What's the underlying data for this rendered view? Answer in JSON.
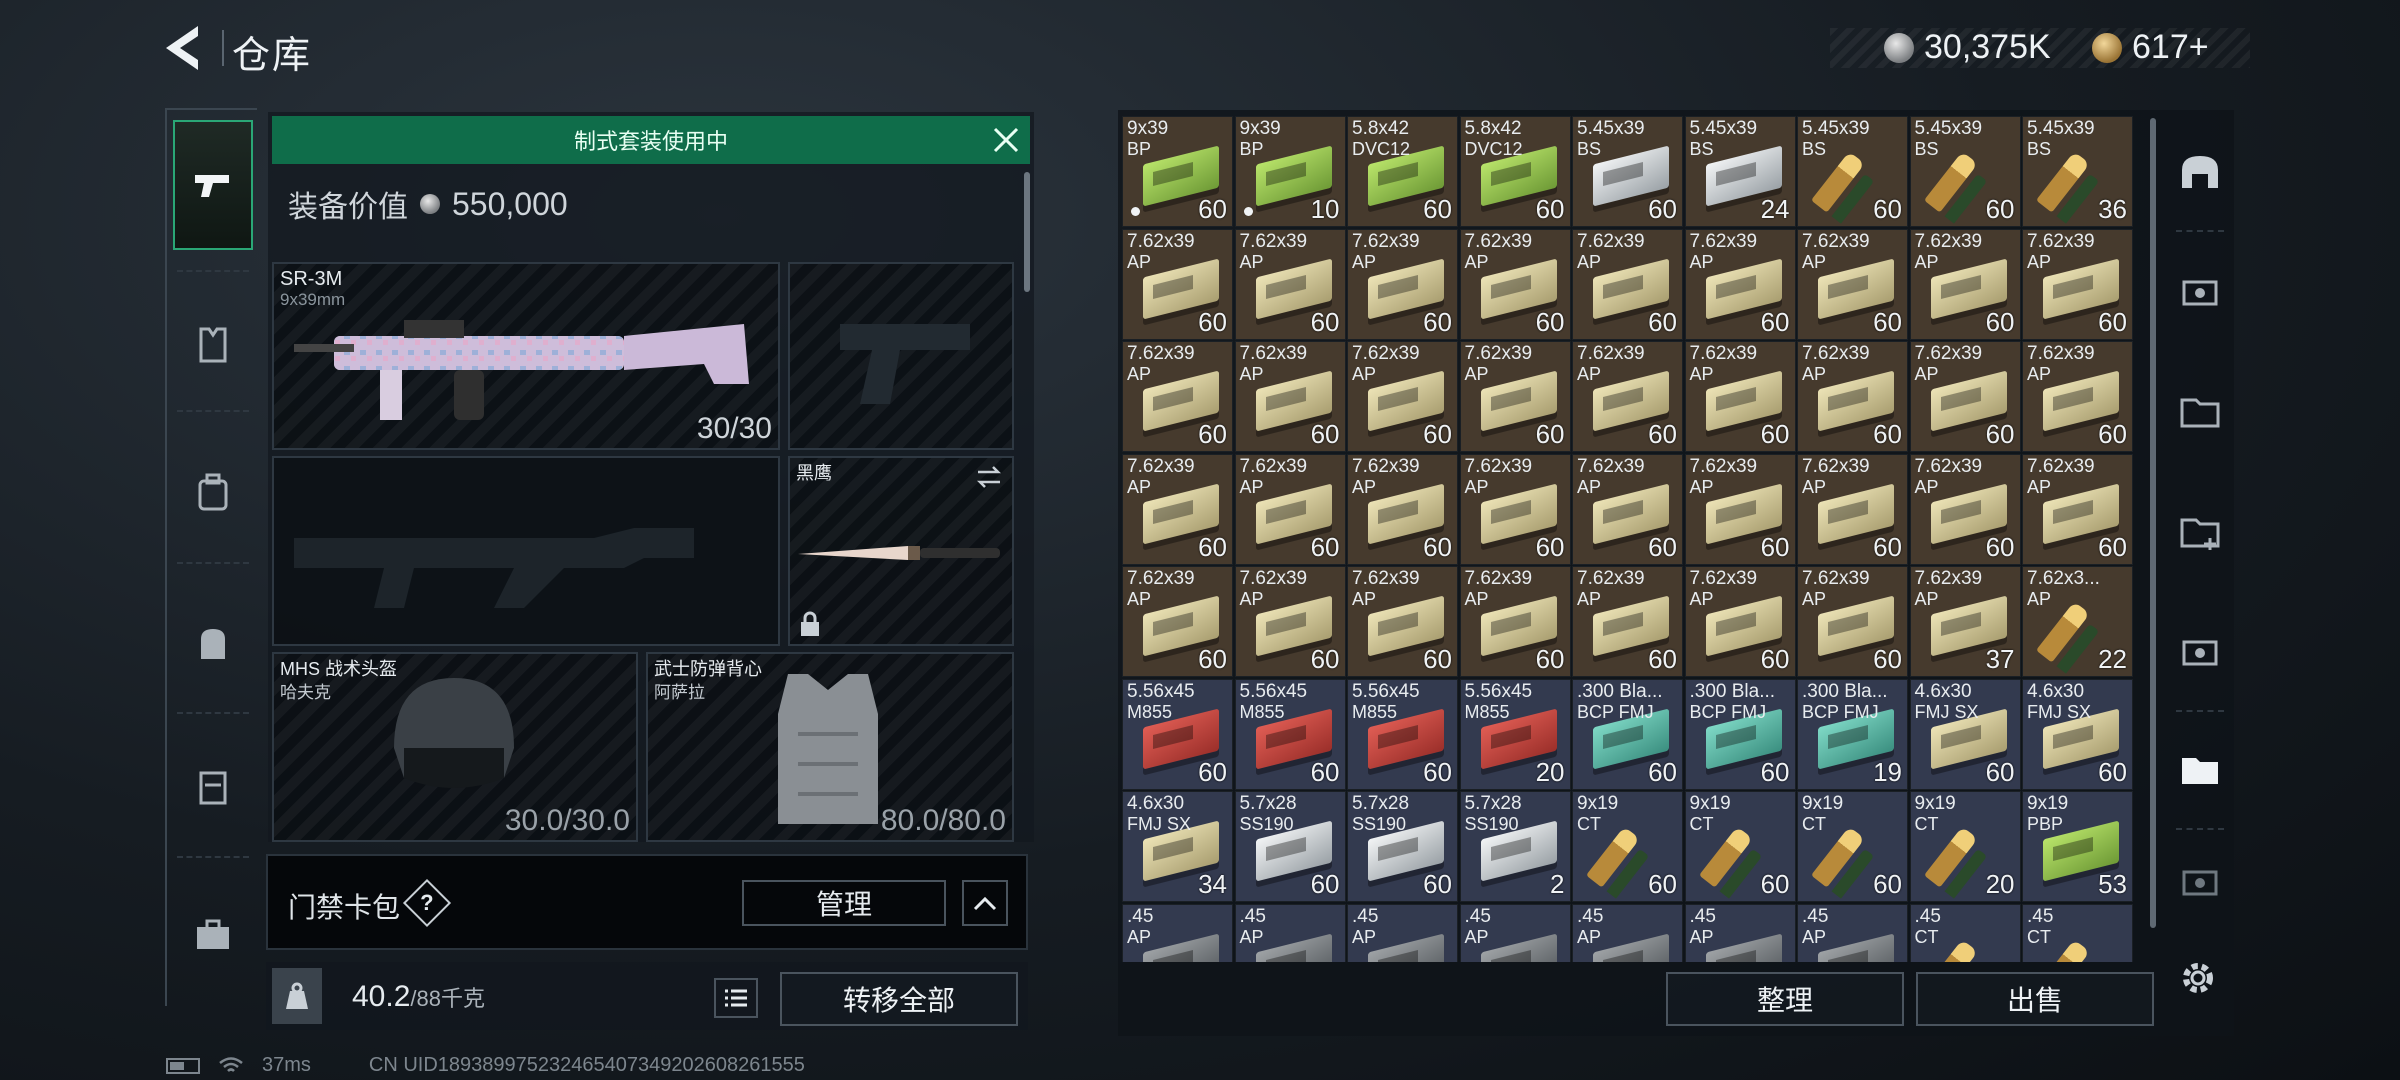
{
  "header": {
    "title": "仓库",
    "currency_silver": "30,375K",
    "currency_gold": "617+"
  },
  "left_tabs": [
    {
      "name": "weapons",
      "icon": "pistol-icon",
      "active": true
    },
    {
      "name": "gear",
      "icon": "vest-icon",
      "active": false
    },
    {
      "name": "backpack",
      "icon": "backpack-icon",
      "active": false
    },
    {
      "name": "bag",
      "icon": "bag-icon",
      "active": false
    },
    {
      "name": "container",
      "icon": "case-icon",
      "active": false
    },
    {
      "name": "toolbox",
      "icon": "toolbox-icon",
      "active": false
    }
  ],
  "loadout": {
    "preset_banner": "制式套装使用中",
    "value_label": "装备价值",
    "value": "550,000",
    "primary": {
      "name": "SR-3M",
      "caliber": "9x39mm",
      "ammo": "30/30"
    },
    "melee": {
      "name": "黑鹰"
    },
    "helmet": {
      "name": "MHS 战术头盔",
      "maker": "哈夫克",
      "durability": "30.0/30.0"
    },
    "armor": {
      "name": "武士防弹背心",
      "maker": "阿萨拉",
      "durability": "80.0/80.0"
    },
    "keycard_label": "门禁卡包",
    "keycard_help": "?",
    "manage_label": "管理",
    "weight": "40.2",
    "weight_max": "/88千克",
    "transfer_label": "转移全部"
  },
  "status": {
    "ping": "37ms",
    "uid": "CN UID1893899752324654073492026082615​55"
  },
  "storage": {
    "sort_label": "整理",
    "sell_label": "出售",
    "cells": [
      {
        "name": "9x39",
        "sub": "BP",
        "qty": "60",
        "color": "brown",
        "box": "green",
        "dot": true
      },
      {
        "name": "9x39",
        "sub": "BP",
        "qty": "10",
        "color": "brown",
        "box": "green",
        "dot": true
      },
      {
        "name": "5.8x42",
        "sub": "DVC12",
        "qty": "60",
        "color": "brown",
        "box": "green"
      },
      {
        "name": "5.8x42",
        "sub": "DVC12",
        "qty": "60",
        "color": "brown",
        "box": "green"
      },
      {
        "name": "5.45x39",
        "sub": "BS",
        "qty": "60",
        "color": "brown",
        "box": "silver"
      },
      {
        "name": "5.45x39",
        "sub": "BS",
        "qty": "24",
        "color": "brown",
        "box": "silver"
      },
      {
        "name": "5.45x39",
        "sub": "BS",
        "qty": "60",
        "color": "brown",
        "box": "bullet"
      },
      {
        "name": "5.45x39",
        "sub": "BS",
        "qty": "60",
        "color": "brown",
        "box": "bullet"
      },
      {
        "name": "5.45x39",
        "sub": "BS",
        "qty": "36",
        "color": "brown",
        "box": "bullet"
      },
      {
        "name": "7.62x39",
        "sub": "AP",
        "qty": "60",
        "color": "brown",
        "box": "tan"
      },
      {
        "name": "7.62x39",
        "sub": "AP",
        "qty": "60",
        "color": "brown",
        "box": "tan"
      },
      {
        "name": "7.62x39",
        "sub": "AP",
        "qty": "60",
        "color": "brown",
        "box": "tan"
      },
      {
        "name": "7.62x39",
        "sub": "AP",
        "qty": "60",
        "color": "brown",
        "box": "tan"
      },
      {
        "name": "7.62x39",
        "sub": "AP",
        "qty": "60",
        "color": "brown",
        "box": "tan"
      },
      {
        "name": "7.62x39",
        "sub": "AP",
        "qty": "60",
        "color": "brown",
        "box": "tan"
      },
      {
        "name": "7.62x39",
        "sub": "AP",
        "qty": "60",
        "color": "brown",
        "box": "tan"
      },
      {
        "name": "7.62x39",
        "sub": "AP",
        "qty": "60",
        "color": "brown",
        "box": "tan"
      },
      {
        "name": "7.62x39",
        "sub": "AP",
        "qty": "60",
        "color": "brown",
        "box": "tan"
      },
      {
        "name": "7.62x39",
        "sub": "AP",
        "qty": "60",
        "color": "brown",
        "box": "tan"
      },
      {
        "name": "7.62x39",
        "sub": "AP",
        "qty": "60",
        "color": "brown",
        "box": "tan"
      },
      {
        "name": "7.62x39",
        "sub": "AP",
        "qty": "60",
        "color": "brown",
        "box": "tan"
      },
      {
        "name": "7.62x39",
        "sub": "AP",
        "qty": "60",
        "color": "brown",
        "box": "tan"
      },
      {
        "name": "7.62x39",
        "sub": "AP",
        "qty": "60",
        "color": "brown",
        "box": "tan"
      },
      {
        "name": "7.62x39",
        "sub": "AP",
        "qty": "60",
        "color": "brown",
        "box": "tan"
      },
      {
        "name": "7.62x39",
        "sub": "AP",
        "qty": "60",
        "color": "brown",
        "box": "tan"
      },
      {
        "name": "7.62x39",
        "sub": "AP",
        "qty": "60",
        "color": "brown",
        "box": "tan"
      },
      {
        "name": "7.62x39",
        "sub": "AP",
        "qty": "60",
        "color": "brown",
        "box": "tan"
      },
      {
        "name": "7.62x39",
        "sub": "AP",
        "qty": "60",
        "color": "brown",
        "box": "tan"
      },
      {
        "name": "7.62x39",
        "sub": "AP",
        "qty": "60",
        "color": "brown",
        "box": "tan"
      },
      {
        "name": "7.62x39",
        "sub": "AP",
        "qty": "60",
        "color": "brown",
        "box": "tan"
      },
      {
        "name": "7.62x39",
        "sub": "AP",
        "qty": "60",
        "color": "brown",
        "box": "tan"
      },
      {
        "name": "7.62x39",
        "sub": "AP",
        "qty": "60",
        "color": "brown",
        "box": "tan"
      },
      {
        "name": "7.62x39",
        "sub": "AP",
        "qty": "60",
        "color": "brown",
        "box": "tan"
      },
      {
        "name": "7.62x39",
        "sub": "AP",
        "qty": "60",
        "color": "brown",
        "box": "tan"
      },
      {
        "name": "7.62x39",
        "sub": "AP",
        "qty": "60",
        "color": "brown",
        "box": "tan"
      },
      {
        "name": "7.62x39",
        "sub": "AP",
        "qty": "60",
        "color": "brown",
        "box": "tan"
      },
      {
        "name": "7.62x39",
        "sub": "AP",
        "qty": "60",
        "color": "brown",
        "box": "tan"
      },
      {
        "name": "7.62x39",
        "sub": "AP",
        "qty": "60",
        "color": "brown",
        "box": "tan"
      },
      {
        "name": "7.62x39",
        "sub": "AP",
        "qty": "60",
        "color": "brown",
        "box": "tan"
      },
      {
        "name": "7.62x39",
        "sub": "AP",
        "qty": "60",
        "color": "brown",
        "box": "tan"
      },
      {
        "name": "7.62x39",
        "sub": "AP",
        "qty": "60",
        "color": "brown",
        "box": "tan"
      },
      {
        "name": "7.62x39",
        "sub": "AP",
        "qty": "60",
        "color": "brown",
        "box": "tan"
      },
      {
        "name": "7.62x39",
        "sub": "AP",
        "qty": "60",
        "color": "brown",
        "box": "tan"
      },
      {
        "name": "7.62x39",
        "sub": "AP",
        "qty": "37",
        "color": "brown",
        "box": "tan"
      },
      {
        "name": "7.62x3...",
        "sub": "AP",
        "qty": "22",
        "color": "brown",
        "box": "bullet"
      },
      {
        "name": "5.56x45",
        "sub": "M855",
        "qty": "60",
        "color": "blue",
        "box": "red"
      },
      {
        "name": "5.56x45",
        "sub": "M855",
        "qty": "60",
        "color": "blue",
        "box": "red"
      },
      {
        "name": "5.56x45",
        "sub": "M855",
        "qty": "60",
        "color": "blue",
        "box": "red"
      },
      {
        "name": "5.56x45",
        "sub": "M855",
        "qty": "20",
        "color": "blue",
        "box": "red"
      },
      {
        "name": ".300 Bla...",
        "sub": "BCP FMJ",
        "qty": "60",
        "color": "blue",
        "box": "teal"
      },
      {
        "name": ".300 Bla...",
        "sub": "BCP FMJ",
        "qty": "60",
        "color": "blue",
        "box": "teal"
      },
      {
        "name": ".300 Bla...",
        "sub": "BCP FMJ",
        "qty": "19",
        "color": "blue",
        "box": "teal"
      },
      {
        "name": "4.6x30",
        "sub": "FMJ SX",
        "qty": "60",
        "color": "blue",
        "box": "tan"
      },
      {
        "name": "4.6x30",
        "sub": "FMJ SX",
        "qty": "60",
        "color": "blue",
        "box": "tan"
      },
      {
        "name": "4.6x30",
        "sub": "FMJ SX",
        "qty": "34",
        "color": "blue",
        "box": "tan"
      },
      {
        "name": "5.7x28",
        "sub": "SS190",
        "qty": "60",
        "color": "blue",
        "box": "silver"
      },
      {
        "name": "5.7x28",
        "sub": "SS190",
        "qty": "60",
        "color": "blue",
        "box": "silver"
      },
      {
        "name": "5.7x28",
        "sub": "SS190",
        "qty": "2",
        "color": "blue",
        "box": "silver"
      },
      {
        "name": "9x19",
        "sub": "CT",
        "qty": "60",
        "color": "blue",
        "box": "bullet"
      },
      {
        "name": "9x19",
        "sub": "CT",
        "qty": "60",
        "color": "blue",
        "box": "bullet"
      },
      {
        "name": "9x19",
        "sub": "CT",
        "qty": "60",
        "color": "blue",
        "box": "bullet"
      },
      {
        "name": "9x19",
        "sub": "CT",
        "qty": "20",
        "color": "blue",
        "box": "bullet"
      },
      {
        "name": "9x19",
        "sub": "PBP",
        "qty": "53",
        "color": "blue",
        "box": "green"
      },
      {
        "name": ".45",
        "sub": "AP",
        "qty": "",
        "color": "blue",
        "box": "gray"
      },
      {
        "name": ".45",
        "sub": "AP",
        "qty": "",
        "color": "blue",
        "box": "gray"
      },
      {
        "name": ".45",
        "sub": "AP",
        "qty": "",
        "color": "blue",
        "box": "gray"
      },
      {
        "name": ".45",
        "sub": "AP",
        "qty": "",
        "color": "blue",
        "box": "gray"
      },
      {
        "name": ".45",
        "sub": "AP",
        "qty": "",
        "color": "blue",
        "box": "gray"
      },
      {
        "name": ".45",
        "sub": "AP",
        "qty": "",
        "color": "blue",
        "box": "gray"
      },
      {
        "name": ".45",
        "sub": "AP",
        "qty": "",
        "color": "blue",
        "box": "gray"
      },
      {
        "name": ".45",
        "sub": "CT",
        "qty": "",
        "color": "blue",
        "box": "bullet"
      },
      {
        "name": ".45",
        "sub": "CT",
        "qty": "",
        "color": "blue",
        "box": "bullet"
      }
    ]
  },
  "colors": {
    "accent": "#0f6d4a",
    "brown_cell": "#463a2d",
    "blue_cell": "#333a4f"
  }
}
